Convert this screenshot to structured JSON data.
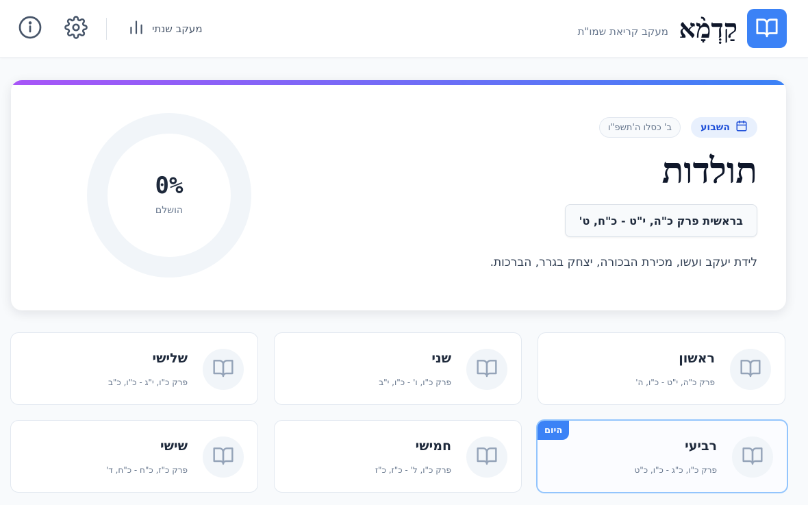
{
  "app": {
    "brand": "קַדְמָ֨א",
    "subtitle": "מעקב קריאת שמו\"ת",
    "nav_tracker_label": "מעקב שנתי"
  },
  "icons": {
    "logo": "open-book-icon",
    "tracker": "bar-chart-icon",
    "settings": "gear-icon",
    "info": "info-icon",
    "week": "calendar-icon",
    "aliyah": "open-book-icon"
  },
  "colors": {
    "accent": "#3b82f6",
    "gradient_end": "#a855f7",
    "today_border": "#93c5fd"
  },
  "hero": {
    "week_label": "השבוע",
    "hebrew_date": "ב' כסלו ה'תשפ\"ו",
    "parsha_name": "תולדות",
    "reading_range": "בראשית פרק כ\"ה, י\"ט - כ\"ח, ט'",
    "summary": "לידת יעקב ועשו, מכירת הבכורה, יצחק בגרר, הברכות.",
    "progress_text": "0%",
    "progress_fraction": 0,
    "progress_label": "הושלם"
  },
  "aliyot": [
    {
      "name": "ראשון",
      "ref": "פרק כ\"ה, י\"ט - כ\"ו, ה'",
      "today": false
    },
    {
      "name": "שני",
      "ref": "פרק כ\"ו, ו' - כ\"ו, י\"ב",
      "today": false
    },
    {
      "name": "שלישי",
      "ref": "פרק כ\"ו, י\"ג - כ\"ו, כ\"ב",
      "today": false
    },
    {
      "name": "רביעי",
      "ref": "פרק כ\"ו, כ\"ג - כ\"ו, כ\"ט",
      "today": true
    },
    {
      "name": "חמישי",
      "ref": "פרק כ\"ו, ל' - כ\"ז, כ\"ז",
      "today": false
    },
    {
      "name": "שישי",
      "ref": "פרק כ\"ז, כ\"ח - כ\"ח, ד'",
      "today": false
    }
  ],
  "today_badge": "היום"
}
